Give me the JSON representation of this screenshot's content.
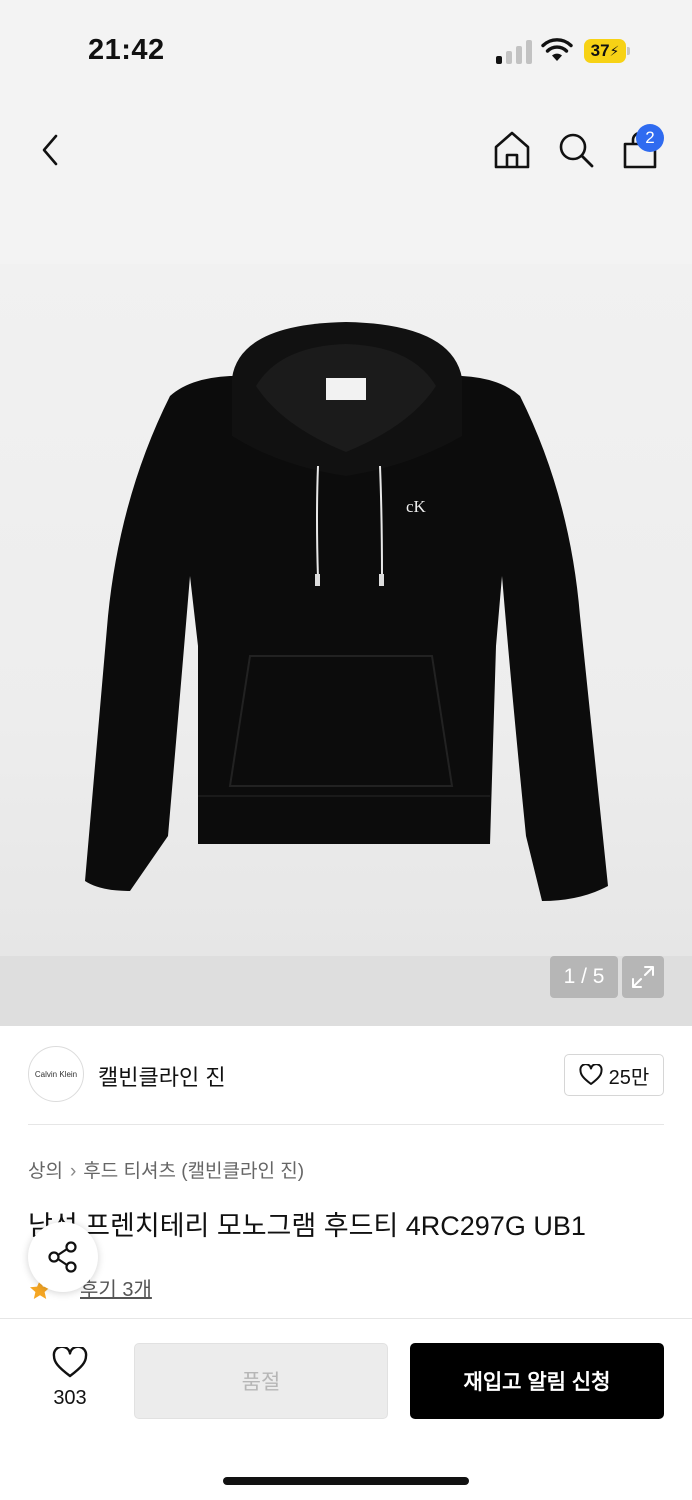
{
  "status_bar": {
    "time": "21:42",
    "battery_level": "37",
    "signal_bars_on": 1,
    "signal_bars_total": 4
  },
  "nav": {
    "cart_count": "2",
    "icons": [
      "chevron-left-icon",
      "home-icon",
      "search-icon",
      "shopping-bag-icon"
    ]
  },
  "gallery": {
    "counter": "1 / 5",
    "current_index": 1,
    "total": 5
  },
  "brand": {
    "logo_text": "Calvin Klein",
    "name": "캘빈클라인 진",
    "likes": "25만"
  },
  "product": {
    "breadcrumb": [
      "상의",
      "후드 티셔츠 (캘빈클라인 진)"
    ],
    "title": "남성 프렌치테리 모노그램 후드티 4RC297G UB1",
    "review_link": "후기 3개"
  },
  "bottom_bar": {
    "wish_count": "303",
    "soldout_label": "품절",
    "restock_label": "재입고 알림 신청"
  },
  "colors": {
    "badge": "#2f6bf0",
    "battery": "#f7d215",
    "primary_button": "#000000",
    "star": "#f5a623"
  }
}
